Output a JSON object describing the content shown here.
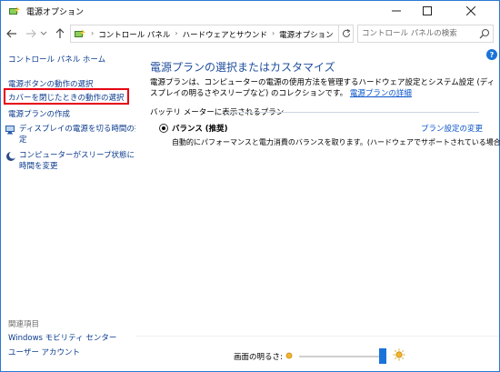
{
  "window": {
    "title": "電源オプション"
  },
  "address": {
    "crumbs": [
      "コントロール パネル",
      "ハードウェアとサウンド",
      "電源オプション"
    ],
    "search_placeholder": "コントロール パネルの検索"
  },
  "sidebar": {
    "home": "コントロール パネル ホーム",
    "items": [
      "電源ボタンの動作の選択",
      "カバーを閉じたときの動作の選択",
      "電源プランの作成",
      "ディスプレイの電源を切る時間の指",
      "定",
      "コンピューターがスリープ状態になる",
      "時間を変更"
    ],
    "related_heading": "関連項目",
    "related": [
      "Windows モビリティ センター",
      "ユーザー アカウント"
    ]
  },
  "main": {
    "title": "電源プランの選択またはカスタマイズ",
    "description": "電源プランは、コンピューターの電源の使用方法を管理するハードウェア設定とシステム設定 (ディスプレイの明るさやスリープなど) のコレクションです。",
    "description_link": "電源プランの詳細",
    "section_heading": "バッテリ メーターに表示されるプラン",
    "plan": {
      "name": "バランス (推奨)",
      "settings_link": "プラン設定の変更",
      "description": "自動的にパフォーマンスと電力消費のバランスを取ります。(ハードウェアでサポートされている場合)",
      "selected": true
    }
  },
  "bottom": {
    "brightness_label": "画面の明るさ:",
    "brightness_level": 0.95
  },
  "colors": {
    "link": "#0a54c9",
    "title": "#1f4e9c",
    "highlight": "#e60012",
    "accent": "#1a73d9"
  }
}
